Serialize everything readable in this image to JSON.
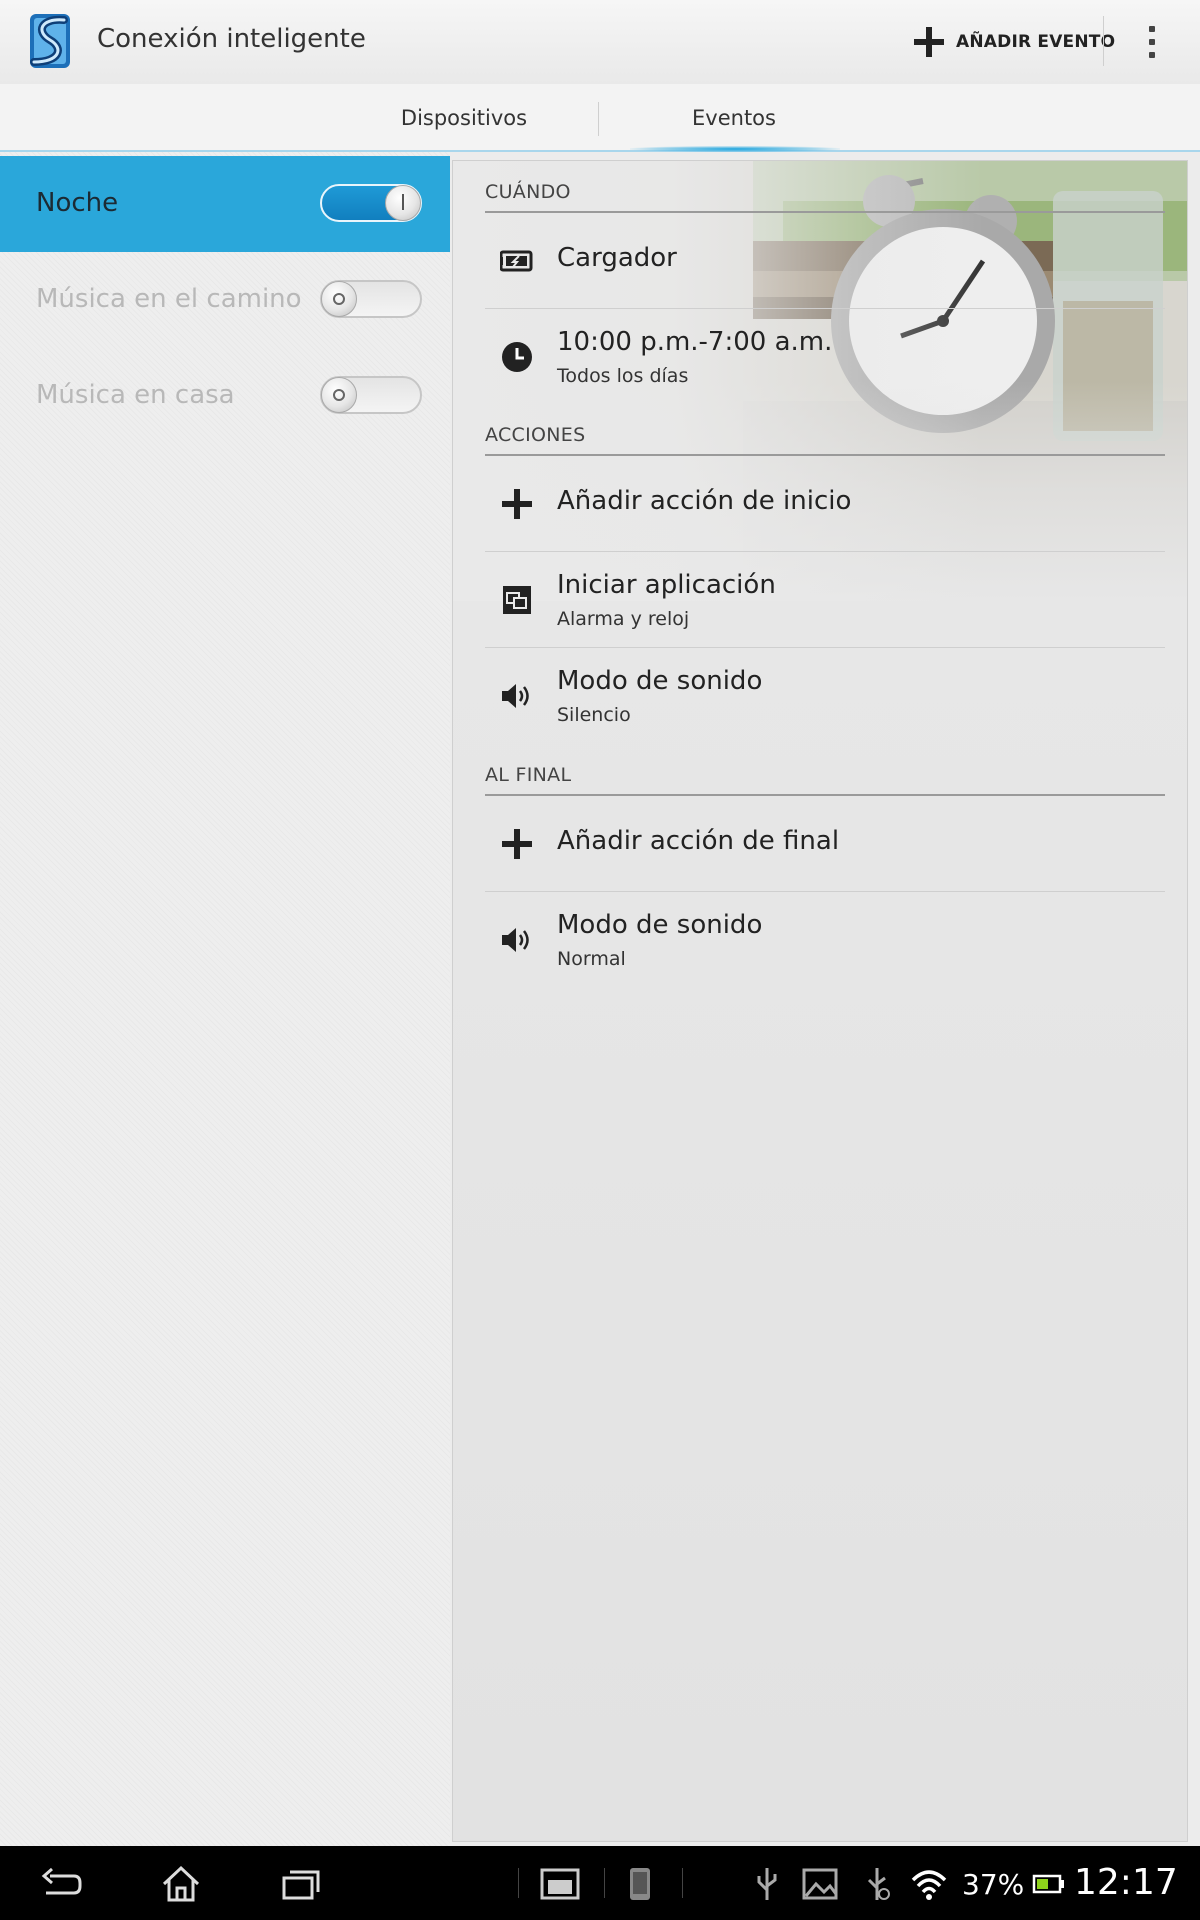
{
  "app": {
    "title": "Conexión inteligente",
    "logo_icon": "smart-connect-logo",
    "add_event_label": "AÑADIR EVENTO",
    "add_event_icon": "plus-icon",
    "overflow_icon": "overflow-menu-icon"
  },
  "tabs": [
    {
      "label": "Dispositivos",
      "selected": false
    },
    {
      "label": "Eventos",
      "selected": true
    }
  ],
  "events": [
    {
      "label": "Noche",
      "enabled": true,
      "selected": true
    },
    {
      "label": "Música en el camino",
      "enabled": false,
      "selected": false
    },
    {
      "label": "Música en casa",
      "enabled": false,
      "selected": false
    }
  ],
  "detail": {
    "when": {
      "header": "CUÁNDO",
      "items": [
        {
          "icon": "charger-icon",
          "title": "Cargador"
        },
        {
          "icon": "clock-icon",
          "title": "10:00 p.m.-7:00 a.m.",
          "subtitle": "Todos los días"
        }
      ]
    },
    "actions": {
      "header": "ACCIONES",
      "items": [
        {
          "icon": "plus-icon",
          "title": "Añadir acción de inicio"
        },
        {
          "icon": "launch-app-icon",
          "title": "Iniciar aplicación",
          "subtitle": "Alarma y reloj"
        },
        {
          "icon": "speaker-icon",
          "title": "Modo de sonido",
          "subtitle": "Silencio"
        }
      ]
    },
    "end": {
      "header": "AL FINAL",
      "items": [
        {
          "icon": "plus-icon",
          "title": "Añadir acción de final"
        },
        {
          "icon": "speaker-icon",
          "title": "Modo de sonido",
          "subtitle": "Normal"
        }
      ]
    }
  },
  "status_bar": {
    "battery_percent": "37%",
    "time": "12:17",
    "icons": [
      "back-icon",
      "home-icon",
      "recent-apps-icon",
      "small-apps-icon",
      "screenshot-icon",
      "usb-icon",
      "image-icon",
      "usb-debug-icon",
      "wifi-icon",
      "battery-icon"
    ]
  },
  "colors": {
    "accent": "#2aa7da",
    "toggle_on": "#1a8fd0",
    "tab_indicator": "#1aa3dd"
  }
}
